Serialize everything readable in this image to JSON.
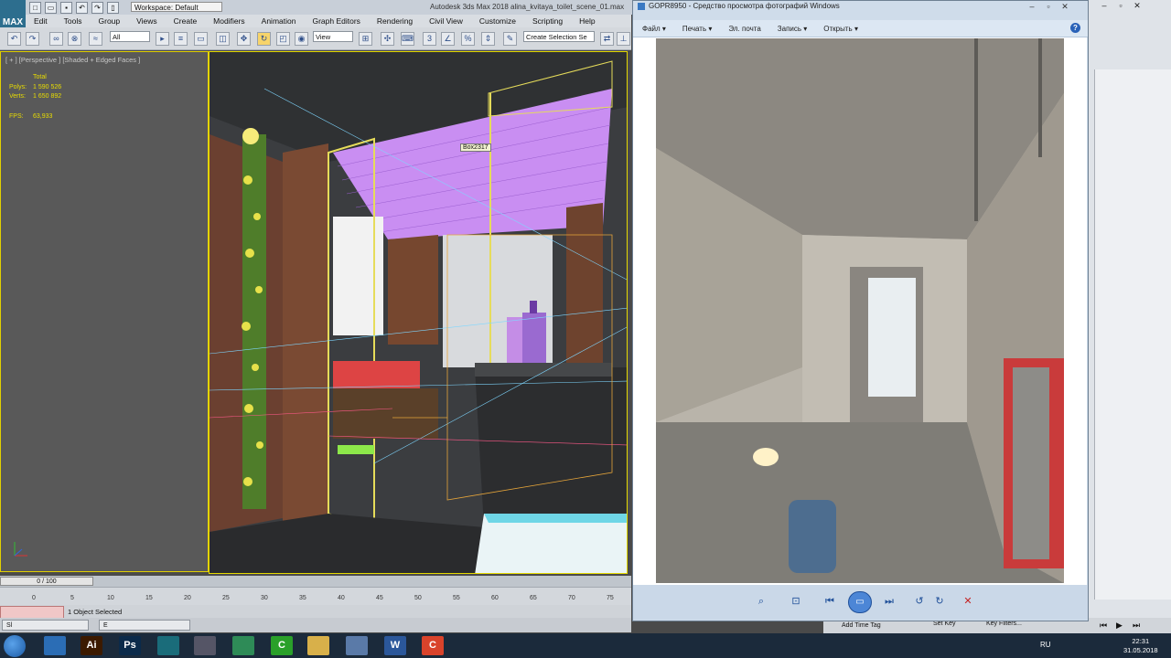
{
  "max_window": {
    "title": "Autodesk 3ds Max 2018   alina_kvitaya_toilet_scene_01.max",
    "logo_text": "MAX",
    "workspace": "Workspace: Default",
    "menu": [
      "Edit",
      "Tools",
      "Group",
      "Views",
      "Create",
      "Modifiers",
      "Animation",
      "Graph Editors",
      "Rendering",
      "Civil View",
      "Customize",
      "Scripting",
      "Help"
    ],
    "toolbar": {
      "filter_value": "All",
      "view_value": "View",
      "selection_set_placeholder": "Create Selection Se"
    },
    "viewport": {
      "label": "[ + ] [Perspective ] [Shaded + Edged Faces ]",
      "stats_total": "Total",
      "polys_label": "Polys:",
      "polys_value": "1 590 526",
      "verts_label": "Verts:",
      "verts_value": "1 650 892",
      "fps_label": "FPS:",
      "fps_value": "63,933",
      "object_label": "Box2317"
    },
    "time_slider": {
      "frame": "0 / 100"
    },
    "ruler_ticks": [
      "0",
      "5",
      "10",
      "15",
      "20",
      "25",
      "30",
      "35",
      "40",
      "45",
      "50",
      "55",
      "60",
      "65",
      "70",
      "75"
    ],
    "status": {
      "selected": "1 Object Selected"
    },
    "mini_tabs": [
      "Sl",
      "E"
    ],
    "key_area": {
      "add_time_tag": "Add Time Tag",
      "set_key": "Set Key",
      "key_filters": "Key Filters..."
    }
  },
  "viewer": {
    "title": "GOPR8950 - Средство просмотра фотографий Windows",
    "menu": [
      "Файл",
      "Печать",
      "Эл. почта",
      "Запись",
      "Открыть"
    ],
    "help": "?",
    "photo_description_colors": {
      "wall": "#b8b3a8",
      "ceiling": "#8f8a82",
      "floor": "#7c7a74"
    }
  },
  "taskbar": {
    "apps": [
      {
        "name": "explorer",
        "label": "",
        "color": "#2b6db5"
      },
      {
        "name": "illustrator",
        "label": "Ai",
        "color": "#3c1a00"
      },
      {
        "name": "photoshop",
        "label": "Ps",
        "color": "#0b2a4a"
      },
      {
        "name": "3dsmax",
        "label": "",
        "color": "#1a6c7a"
      },
      {
        "name": "media",
        "label": "",
        "color": "#556"
      },
      {
        "name": "chrome",
        "label": "",
        "color": "#2e8b57"
      },
      {
        "name": "camtasia",
        "label": "C",
        "color": "#2aa02a"
      },
      {
        "name": "folder",
        "label": "",
        "color": "#d8b04a"
      },
      {
        "name": "photos",
        "label": "",
        "color": "#5a7aa8"
      },
      {
        "name": "word",
        "label": "W",
        "color": "#2b579a"
      },
      {
        "name": "recorder",
        "label": "C",
        "color": "#d9432b"
      }
    ],
    "language": "RU",
    "time": "22:31",
    "date": "31.05.2018"
  }
}
